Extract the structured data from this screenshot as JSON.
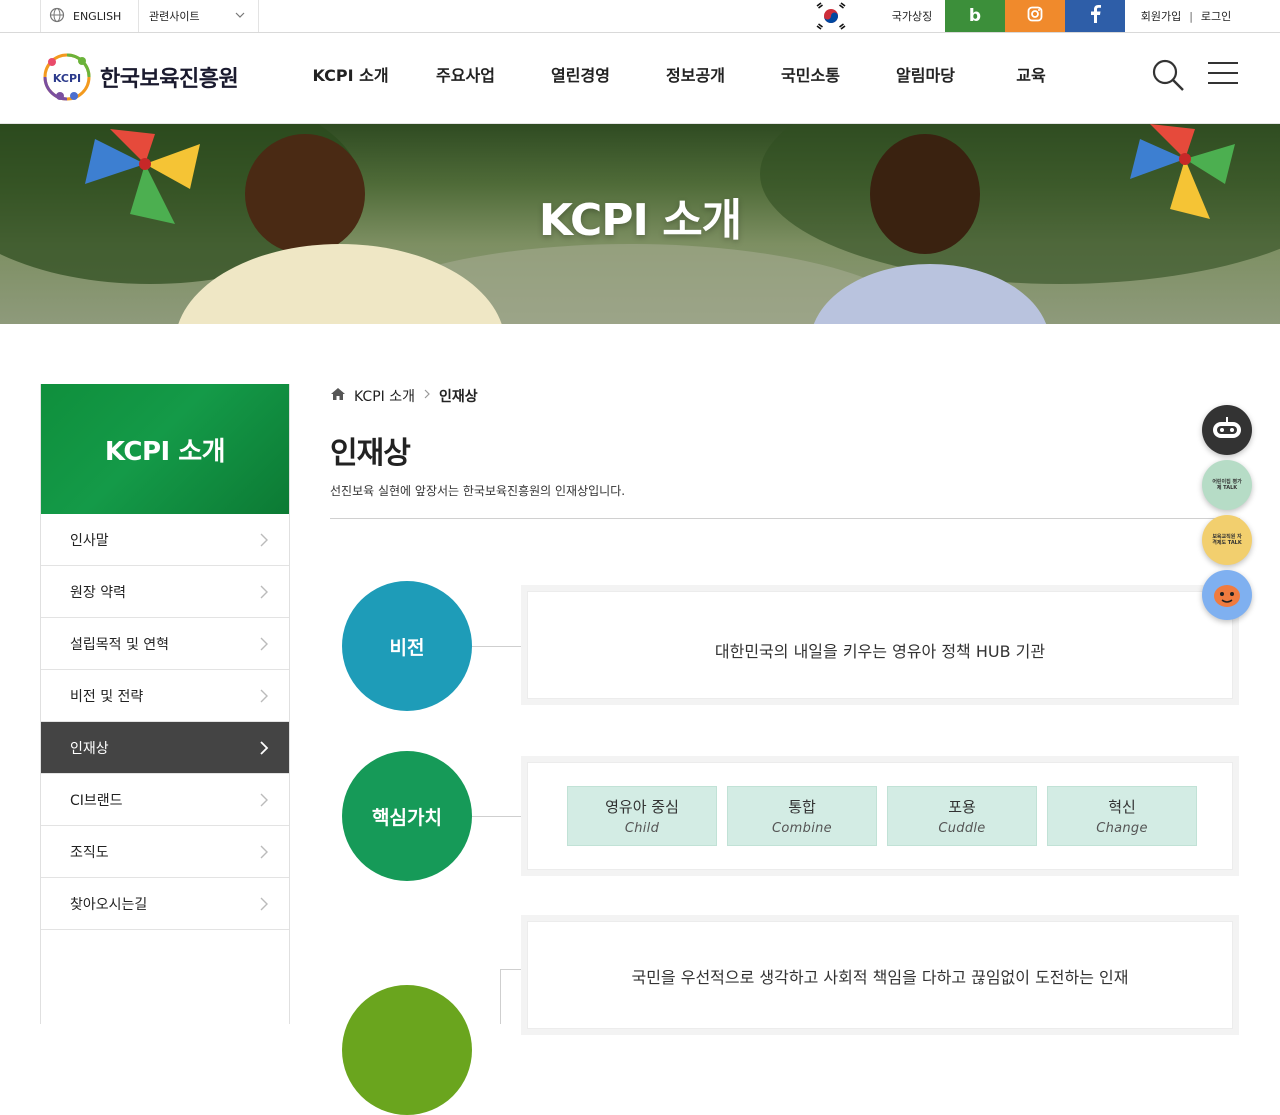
{
  "utility": {
    "language": "ENGLISH",
    "related_sites": "관련사이트",
    "national_symbol": "국가상징",
    "sns": {
      "blog": "b"
    },
    "signup": "회원가입",
    "separator": "|",
    "login": "로그인"
  },
  "header": {
    "logo_mark": "KCPI",
    "logo_text": "한국보육진흥원",
    "nav": [
      "KCPI 소개",
      "주요사업",
      "열린경영",
      "정보공개",
      "국민소통",
      "알림마당",
      "교육"
    ]
  },
  "hero": {
    "title": "KCPI 소개"
  },
  "lnb": {
    "title": "KCPI 소개",
    "items": [
      "인사말",
      "원장 약력",
      "설립목적 및 연혁",
      "비전 및 전략",
      "인재상",
      "CI브랜드",
      "조직도",
      "찾아오시는길"
    ],
    "active_index": 4
  },
  "breadcrumb": {
    "parent": "KCPI 소개",
    "current": "인재상"
  },
  "page": {
    "title": "인재상",
    "description": "선진보육 실현에 앞장서는 한국보육진흥원의 인재상입니다."
  },
  "vision": {
    "label": "비전",
    "text": "대한민국의 내일을 키우는 영유아 정책 HUB 기관",
    "color": "#1e9cb8"
  },
  "core_values": {
    "label": "핵심가치",
    "color": "#169a58",
    "items": [
      {
        "ko": "영유아 중심",
        "en": "Child"
      },
      {
        "ko": "통합",
        "en": "Combine"
      },
      {
        "ko": "포용",
        "en": "Cuddle"
      },
      {
        "ko": "혁신",
        "en": "Change"
      }
    ]
  },
  "talent": {
    "text": "국민을 우선적으로 생각하고 사회적 책임을 다하고 끊임없이 도전하는 인재",
    "color": "#6aa51e"
  },
  "quick_menu": {
    "talk1": "어린이집 평가제 TALK",
    "talk2": "보육교직원 자격제도 TALK"
  },
  "colors": {
    "accent_green": "#149a48",
    "active_gray": "#444444"
  }
}
